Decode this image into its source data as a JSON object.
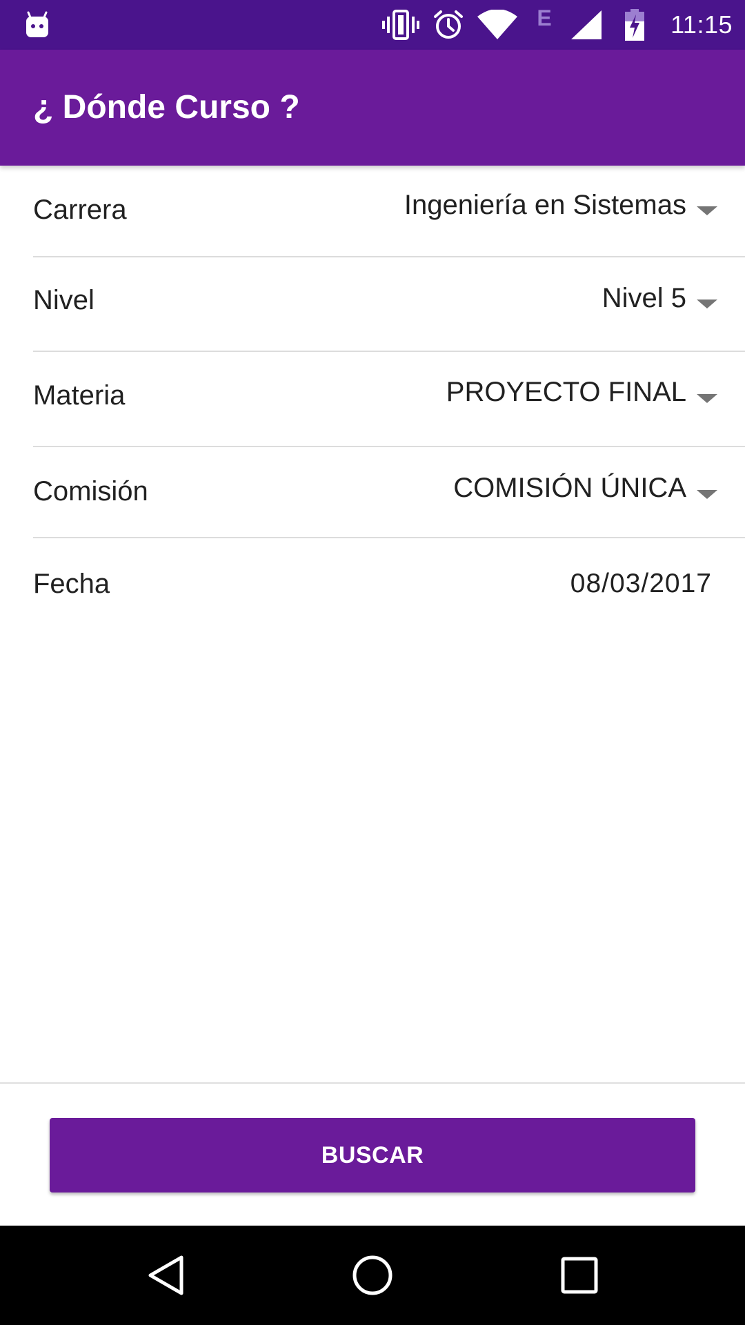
{
  "status_bar": {
    "time": "11:15",
    "network_type": "E",
    "icons": [
      "android-notification-icon",
      "vibrate-icon",
      "alarm-icon",
      "wifi-icon",
      "signal-icon",
      "battery-charging-icon"
    ]
  },
  "app_bar": {
    "title": "¿ Dónde Curso ?"
  },
  "form": {
    "carrera": {
      "label": "Carrera",
      "value": "Ingeniería en Sistemas"
    },
    "nivel": {
      "label": "Nivel",
      "value": "Nivel 5"
    },
    "materia": {
      "label": "Materia",
      "value": "PROYECTO FINAL"
    },
    "comision": {
      "label": "Comisión",
      "value": "COMISIÓN ÚNICA"
    },
    "fecha": {
      "label": "Fecha",
      "value": "08/03/2017"
    }
  },
  "actions": {
    "search_label": "BUSCAR"
  },
  "nav_bar": {
    "icons": [
      "back-icon",
      "home-icon",
      "recents-icon"
    ]
  },
  "colors": {
    "status_bar": "#4a148c",
    "primary": "#6a1b9a",
    "text": "#212121",
    "divider": "#dcdcdc",
    "caret": "#757575",
    "nav_bar": "#000000"
  }
}
